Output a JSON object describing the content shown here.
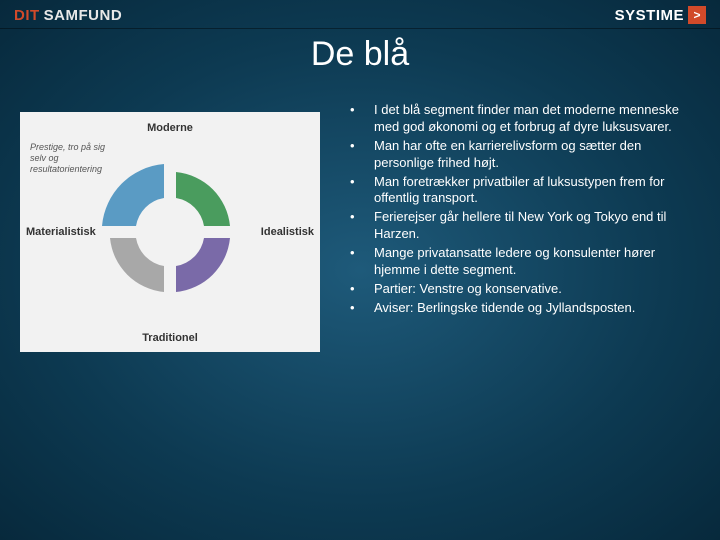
{
  "header": {
    "left_brand_part1": "DIT",
    "left_brand_part2": "SAMFUND",
    "right_brand": "SYSTIME",
    "right_arrow": ">"
  },
  "title": "De blå",
  "diagram": {
    "top": "Moderne",
    "bottom": "Traditionel",
    "left": "Materialistisk",
    "right": "Idealistisk",
    "corner_top_left": "Prestige, tro på sig selv og resultatorientering",
    "colors": {
      "blue": "#5a9bc4",
      "green": "#4a9c5e",
      "purple": "#7a6aa8",
      "grey": "#a8a8a8"
    }
  },
  "bullets": [
    "I det blå segment finder man det moderne menneske med god økonomi og et forbrug af dyre luksusvarer.",
    "Man har ofte en karrierelivsform og sætter den personlige frihed højt.",
    "Man foretrækker privatbiler af luksustypen frem for offentlig transport.",
    "Ferierejser går hellere til New York og Tokyo end til Harzen.",
    "Mange privatansatte ledere og konsulenter hører hjemme i dette segment.",
    "Partier: Venstre og konservative.",
    "Aviser: Berlingske tidende og Jyllandsposten."
  ]
}
